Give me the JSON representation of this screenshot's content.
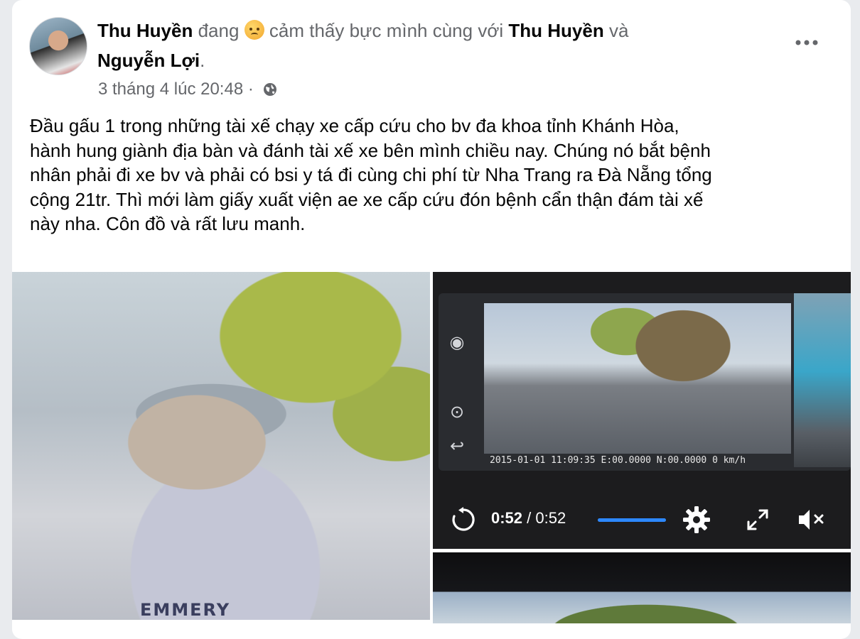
{
  "post": {
    "author": "Thu Huyền",
    "feeling_prefix": "đang",
    "feeling_text": "cảm thấy bực mình cùng với",
    "tagged_1": "Thu Huyền",
    "conjunction": "và",
    "tagged_2": "Nguyễn Lợi",
    "period": ".",
    "timestamp": "3 tháng 4 lúc 20:48",
    "separator": "·",
    "privacy_icon": "globe-icon",
    "more_icon": "more-horizontal-icon",
    "emoji_icon": "angry-face-emoji",
    "text_lines": [
      "Đầu gấu 1 trong những tài xế chạy xe cấp cứu cho bv đa khoa tỉnh Khánh Hòa,",
      "hành hung giành địa bàn và đánh tài xế xe bên mình chiều nay. Chúng nó bắt bệnh",
      "nhân phải đi xe bv và phải có bsi y tá đi cùng chi phí từ Nha Trang ra Đà Nẵng tổng",
      "cộng 21tr. Thì mới làm giấy xuất viện ae xe cấp cứu đón bệnh cẩn thận đám tài xế",
      "này nha. Côn đồ và rất lưu manh."
    ]
  },
  "photos": {
    "left_shirt_text": "EMMERY",
    "dashcam_overlay": "2015-01-01 11:09:35   E:00.0000 N:00.0000   0 km/h"
  },
  "video": {
    "current_time": "0:52",
    "divider": "/",
    "duration": "0:52",
    "progress": 1.0,
    "accent_color": "#2d88ff",
    "replay_icon": "replay-icon",
    "settings_icon": "gear-icon",
    "fullscreen_icon": "fullscreen-icon",
    "mute_icon": "volume-muted-icon"
  }
}
